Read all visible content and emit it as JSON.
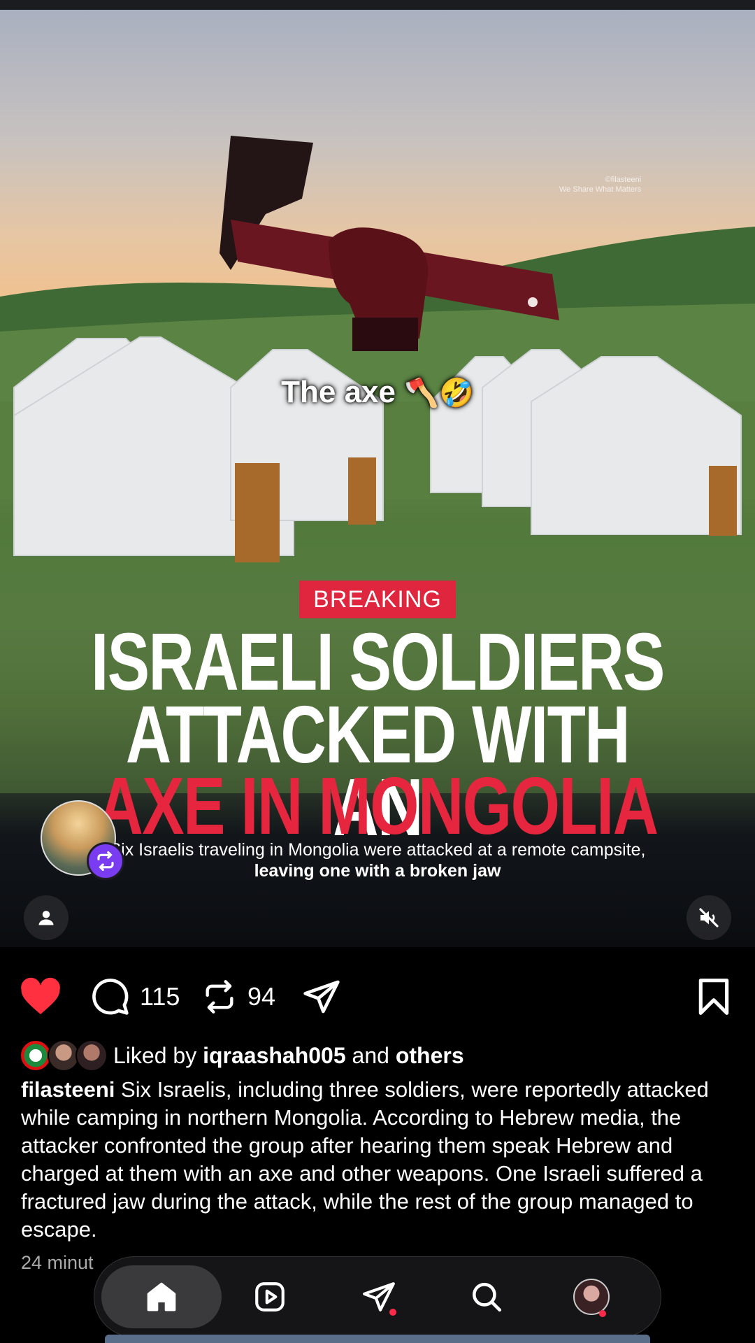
{
  "media": {
    "overlay_caption": "The axe",
    "overlay_emojis": "🪓🤣",
    "watermark_line1": "©filasteeni",
    "watermark_line2": "We Share What Matters",
    "breaking_label": "BREAKING",
    "headline_line1": "ISRAELI SOLDIERS",
    "headline_line2": "ATTACKED WITH AN",
    "headline_line3": "AXE IN MONGOLIA",
    "subline_regular": "Six Israelis traveling in Mongolia were attacked at a remote campsite,",
    "subline_bold": "leaving one with a broken jaw"
  },
  "actions": {
    "comment_count": "115",
    "repost_count": "94",
    "like_color": "#ff3040"
  },
  "liked_by": {
    "prefix": "Liked by",
    "user": "iqraashah005",
    "and": "and",
    "others": "others"
  },
  "post": {
    "username": "filasteeni",
    "caption": "Six Israelis, including three soldiers, were reportedly attacked while camping in northern Mongolia. According to Hebrew media, the attacker confronted the group after hearing them speak Hebrew and charged at them with an axe and other weapons. One Israeli suffered a fractured jaw during the attack, while the rest of the group managed to escape.",
    "time": "24 minut"
  },
  "nav": {
    "items": [
      "home-icon",
      "reels-icon",
      "share-icon",
      "search-icon",
      "profile-avatar"
    ]
  },
  "colors": {
    "breaking_bg": "#e0263e",
    "headline_red": "#e6263e",
    "repost_badge": "#7a3cf0"
  }
}
